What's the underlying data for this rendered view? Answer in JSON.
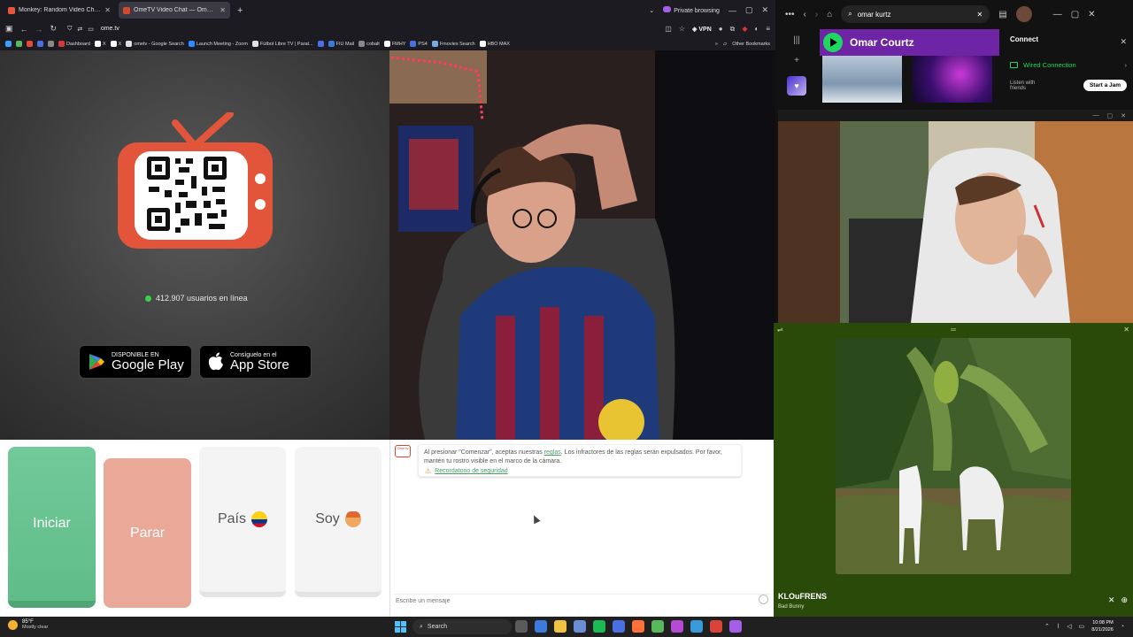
{
  "browser": {
    "tabs": [
      {
        "title": "Monkey: Random Video Chat |",
        "active": false,
        "favicon_color": "#e8543c"
      },
      {
        "title": "OmeTV Video Chat — Omegle",
        "active": true,
        "favicon_color": "#d24a2e"
      }
    ],
    "private_label": "Private browsing",
    "url": "ome.tv",
    "vpn_label": "VPN",
    "bookmarks": [
      {
        "label": "",
        "color": "#3aa0ff"
      },
      {
        "label": "",
        "color": "#57b85c"
      },
      {
        "label": "",
        "color": "#e04a3a"
      },
      {
        "label": "",
        "color": "#4a6fe0"
      },
      {
        "label": "",
        "color": "#888"
      },
      {
        "label": "Dashboard",
        "color": "#d23a3a"
      },
      {
        "label": "X",
        "color": "#ffffff"
      },
      {
        "label": "X",
        "color": "#ffffff"
      },
      {
        "label": "ometv - Google Search",
        "color": "#e0e0e0"
      },
      {
        "label": "Launch Meeting - Zoom",
        "color": "#2d8cff"
      },
      {
        "label": "Fútbol Libre TV | Parat...",
        "color": "#e0e0e0"
      },
      {
        "label": "",
        "color": "#4a6fe0"
      },
      {
        "label": "FIU Mail",
        "color": "#3a7ad9"
      },
      {
        "label": "cobalt",
        "color": "#888"
      },
      {
        "label": "FMHY",
        "color": "#fff"
      },
      {
        "label": "PS4",
        "color": "#4a6fe0"
      },
      {
        "label": "Fmovies Search",
        "color": "#7ad"
      },
      {
        "label": "HBO MAX",
        "color": "#fff"
      }
    ],
    "other_bookmarks": "Other Bookmarks"
  },
  "ome": {
    "online_text": "412.907 usuarios en línea",
    "google_play": {
      "small": "DISPONIBLE EN",
      "big": "Google Play"
    },
    "app_store": {
      "small": "Consíguelo en el",
      "big": "App Store"
    },
    "start_label": "Iniciar",
    "stop_label": "Parar",
    "country_label": "País",
    "gender_label": "Soy",
    "notice_pre": "Al presionar \"Comenzar\", aceptas nuestras ",
    "notice_link": "reglas",
    "notice_post": ". Los infractores de las reglas serán expulsados. Por favor, mantén tu rostro visible en el marco de la cámara.",
    "safety_link": "Recordatorio de seguridad",
    "message_placeholder": "Escribe un mensaje",
    "chat_logo": "Ome tv"
  },
  "spotify": {
    "search_value": "omar kurtz",
    "artist_name": "Omar Courtz",
    "connect_title": "Connect",
    "wired_label": "Wired Connection",
    "listen_label": "Listen with friends",
    "jam_label": "Start a Jam"
  },
  "player": {
    "track": "KLOuFRENS",
    "artist": "Bad Bunny"
  },
  "taskbar": {
    "temp": "85°F",
    "weather": "Mostly clear",
    "search": "Search",
    "time": "10:08 PM",
    "date": "8/21/2026",
    "apps": [
      "#5a5a5a",
      "#3c7bd9",
      "#f2c243",
      "#6a8ed6",
      "#1db954",
      "#4a6fe0",
      "#ff7139",
      "#57b85c",
      "#b44ad6",
      "#3a9ad9",
      "#d9433a",
      "#a55ee8"
    ]
  }
}
